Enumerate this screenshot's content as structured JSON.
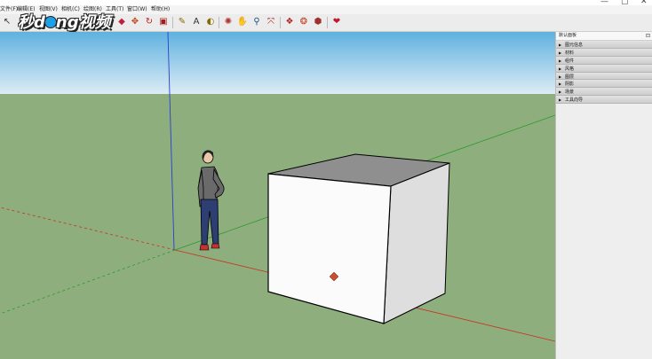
{
  "menu": [
    {
      "label": "文件(F)"
    },
    {
      "label": "编辑(E)"
    },
    {
      "label": "视图(V)"
    },
    {
      "label": "相机(C)"
    },
    {
      "label": "绘图(R)"
    },
    {
      "label": "工具(T)"
    },
    {
      "label": "窗口(W)"
    },
    {
      "label": "帮助(H)"
    }
  ],
  "logo": {
    "text_a": "秒d",
    "text_b": "ng视频"
  },
  "window_controls": {
    "minimize": "—",
    "maximize": "▢",
    "close": "✕"
  },
  "panel": {
    "title": "默认面板",
    "pin": "⊡",
    "trays": [
      {
        "label": "图元信息"
      },
      {
        "label": "材料"
      },
      {
        "label": "组件"
      },
      {
        "label": "风格"
      },
      {
        "label": "图层"
      },
      {
        "label": "阴影"
      },
      {
        "label": "场景"
      },
      {
        "label": "工具向导"
      }
    ]
  },
  "toolbar_icons": [
    "select-arrow-icon",
    "eraser-icon",
    "paint-bucket-icon",
    "push-pull-icon",
    "move-icon",
    "rotate-icon",
    "scale-icon",
    "tape-measure-icon",
    "text-icon",
    "protractor-icon",
    "orbit-icon",
    "pan-icon",
    "zoom-icon",
    "zoom-extents-icon",
    "warehouse-icon",
    "components-icon",
    "share-model-icon",
    "extension-icon"
  ],
  "colors": {
    "sky_top": "#5fb1df",
    "sky_bottom": "#dcecf5",
    "ground": "#8fae7e",
    "axis_red": "#c8321e",
    "axis_green": "#2a9a2a",
    "axis_blue": "#2a3fd0",
    "box_front": "#fbfbfb",
    "box_side": "#dedede",
    "box_top": "#8f8f8f"
  }
}
